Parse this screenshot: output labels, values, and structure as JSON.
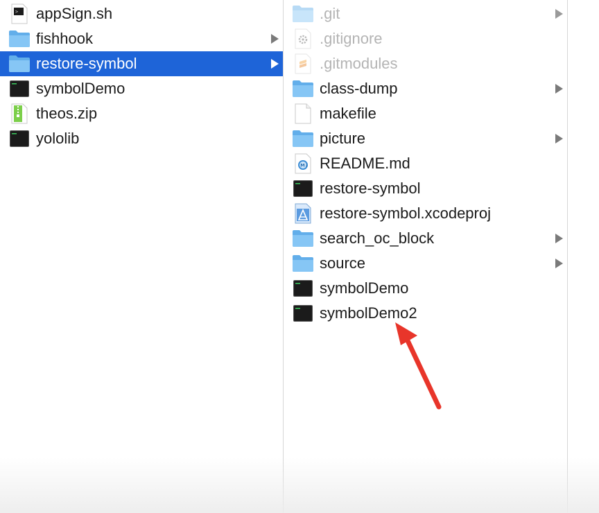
{
  "columns": {
    "left": {
      "items": [
        {
          "label": "appSign.sh",
          "icon": "shell-script-icon",
          "has_children": false,
          "selected": false
        },
        {
          "label": "fishhook",
          "icon": "folder-icon",
          "has_children": true,
          "selected": false
        },
        {
          "label": "restore-symbol",
          "icon": "folder-icon",
          "has_children": true,
          "selected": true
        },
        {
          "label": "symbolDemo",
          "icon": "unix-executable-icon",
          "has_children": false,
          "selected": false
        },
        {
          "label": "theos.zip",
          "icon": "zip-archive-icon",
          "has_children": false,
          "selected": false
        },
        {
          "label": "yololib",
          "icon": "unix-executable-icon",
          "has_children": false,
          "selected": false
        }
      ]
    },
    "middle": {
      "items": [
        {
          "label": ".git",
          "icon": "folder-icon",
          "has_children": true,
          "hidden_file": true
        },
        {
          "label": ".gitignore",
          "icon": "gear-document-icon",
          "has_children": false,
          "hidden_file": true
        },
        {
          "label": ".gitmodules",
          "icon": "sublime-document-icon",
          "has_children": false,
          "hidden_file": true
        },
        {
          "label": "class-dump",
          "icon": "folder-icon",
          "has_children": true,
          "hidden_file": false
        },
        {
          "label": "makefile",
          "icon": "blank-document-icon",
          "has_children": false,
          "hidden_file": false
        },
        {
          "label": "picture",
          "icon": "folder-icon",
          "has_children": true,
          "hidden_file": false
        },
        {
          "label": "README.md",
          "icon": "markdown-document-icon",
          "has_children": false,
          "hidden_file": false
        },
        {
          "label": "restore-symbol",
          "icon": "unix-executable-icon",
          "has_children": false,
          "hidden_file": false
        },
        {
          "label": "restore-symbol.xcodeproj",
          "icon": "xcode-project-icon",
          "has_children": false,
          "hidden_file": false
        },
        {
          "label": "search_oc_block",
          "icon": "folder-icon",
          "has_children": true,
          "hidden_file": false
        },
        {
          "label": "source",
          "icon": "folder-icon",
          "has_children": true,
          "hidden_file": false
        },
        {
          "label": "symbolDemo",
          "icon": "unix-executable-icon",
          "has_children": false,
          "hidden_file": false
        },
        {
          "label": "symbolDemo2",
          "icon": "unix-executable-icon",
          "has_children": false,
          "hidden_file": false
        }
      ]
    }
  },
  "annotation": {
    "type": "arrow",
    "color": "#e8352a",
    "points_to": "symbolDemo2"
  },
  "colors": {
    "selection": "#1e64d8",
    "folder": "#6ab6f0",
    "hidden_text": "#b4b4b4"
  }
}
